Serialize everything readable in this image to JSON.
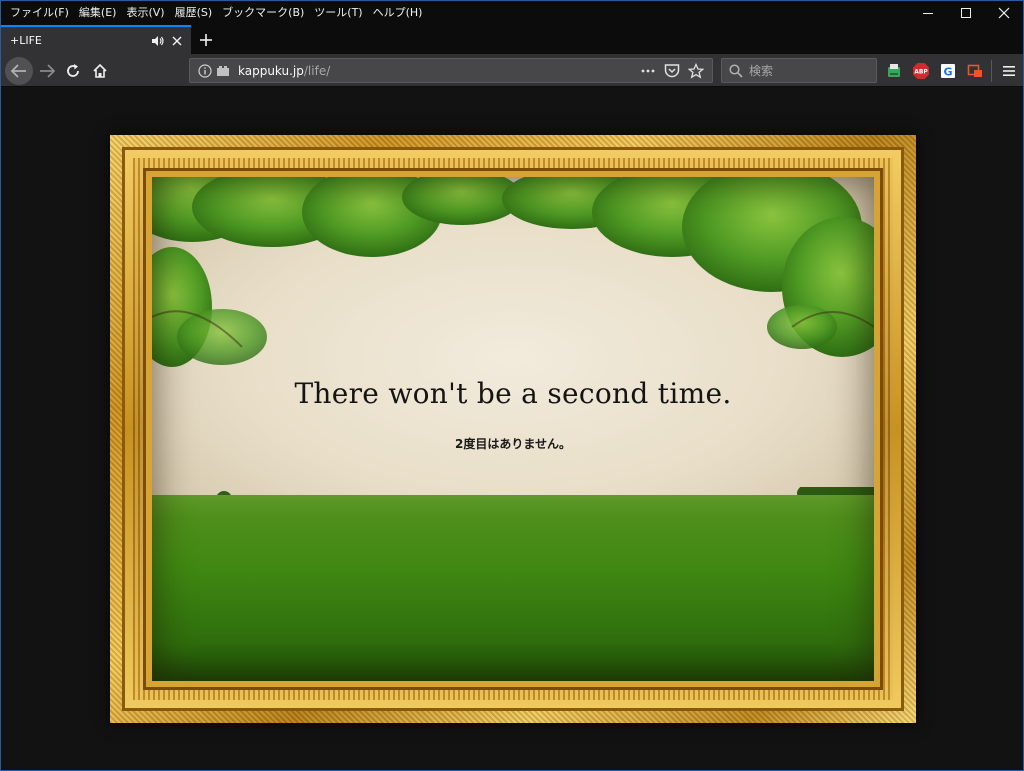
{
  "menubar": {
    "items": [
      "ファイル(F)",
      "編集(E)",
      "表示(V)",
      "履歴(S)",
      "ブックマーク(B)",
      "ツール(T)",
      "ヘルプ(H)"
    ]
  },
  "tab": {
    "title": "+LIFE"
  },
  "urlbar": {
    "domain": "kappuku.jp",
    "path": "/life/"
  },
  "search": {
    "placeholder": "検索"
  },
  "extensions": {
    "abp_label": "ABP",
    "g_label": "G"
  },
  "page": {
    "headline": "There won't be a second time.",
    "subline": "2度目はありません。"
  },
  "colors": {
    "accent": "#0a84ff",
    "toolbar": "#323234",
    "frame_gold": "#d6a434"
  }
}
